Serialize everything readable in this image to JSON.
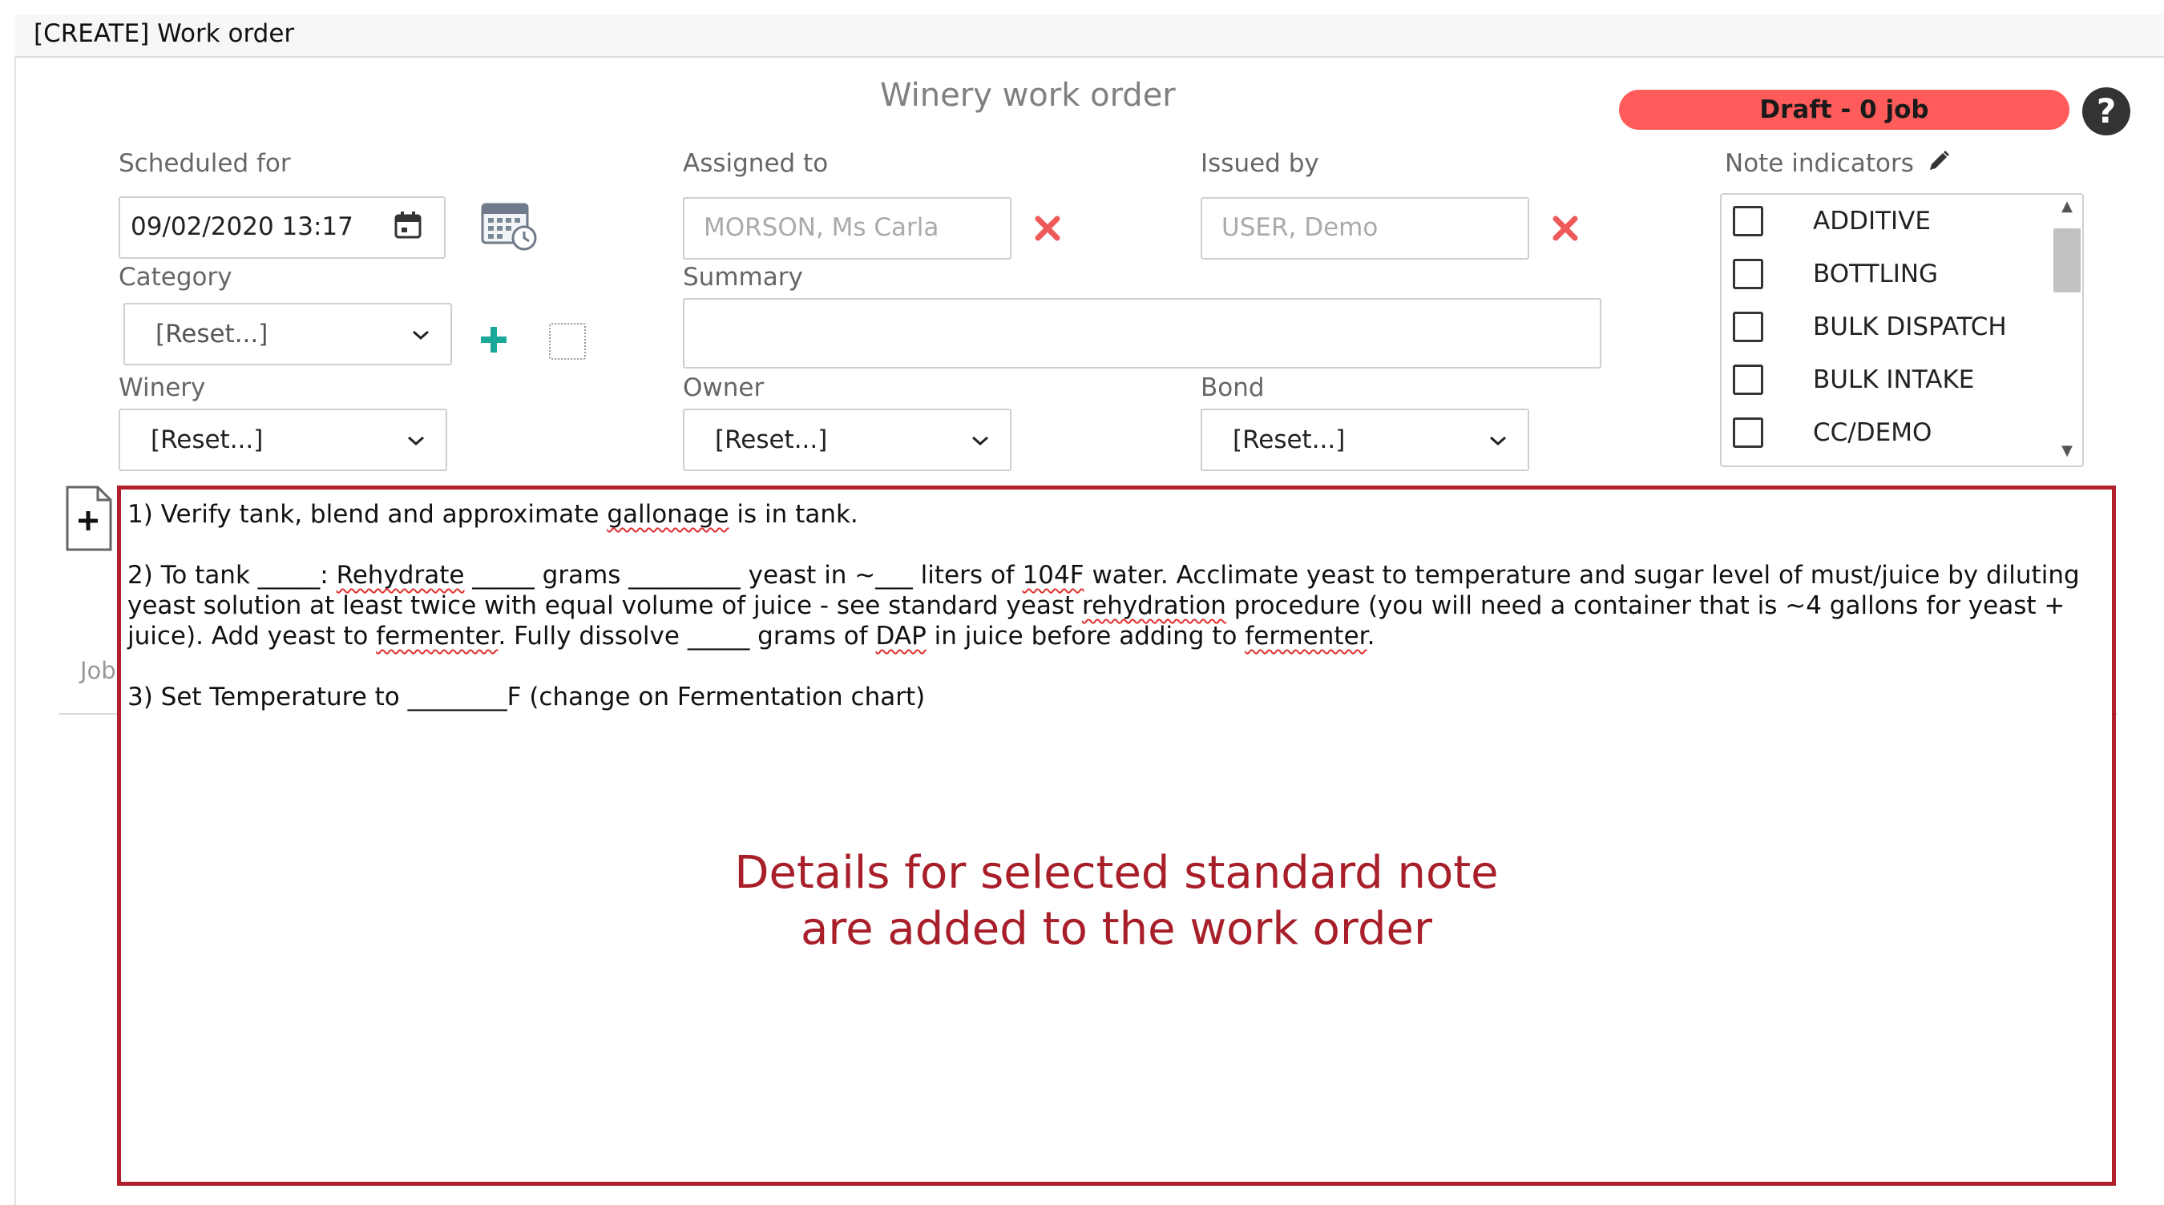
{
  "window": {
    "title": "[CREATE] Work order"
  },
  "header": {
    "title": "Winery work order",
    "status": "Draft - 0 job",
    "status_color": "#ff5b5b",
    "help_icon": "question-mark-icon"
  },
  "form": {
    "scheduled_for": {
      "label": "Scheduled for",
      "value": "09/02/2020 13:17"
    },
    "assigned_to": {
      "label": "Assigned to",
      "value": "MORSON, Ms Carla"
    },
    "issued_by": {
      "label": "Issued by",
      "value": "USER, Demo"
    },
    "category": {
      "label": "Category",
      "value": "[Reset...]"
    },
    "summary": {
      "label": "Summary",
      "value": ""
    },
    "winery": {
      "label": "Winery",
      "value": "[Reset...]"
    },
    "owner": {
      "label": "Owner",
      "value": "[Reset...]"
    },
    "bond": {
      "label": "Bond",
      "value": "[Reset...]"
    }
  },
  "note_indicators": {
    "label": "Note indicators",
    "items": [
      {
        "label": "ADDITIVE",
        "checked": false
      },
      {
        "label": "BOTTLING",
        "checked": false
      },
      {
        "label": "BULK DISPATCH",
        "checked": false
      },
      {
        "label": "BULK INTAKE",
        "checked": false
      },
      {
        "label": "CC/DEMO",
        "checked": false
      }
    ]
  },
  "tabs": {
    "job": "Job"
  },
  "note": {
    "line1": {
      "a": "1) Verify tank, blend and approximate ",
      "b": "gallonage",
      "c": " is in tank."
    },
    "line2": {
      "a": "2) To tank _____: ",
      "b": "Rehydrate",
      "c": " _____ grams _________ yeast in ~___ liters of ",
      "d": "104F",
      "e": " water.   Acclimate yeast to temperature and sugar level of must/juice by diluting yeast solution at least twice with equal volume of juice - see standard yeast ",
      "f": "rehydration",
      "g": " procedure (you will need a container that is ~4 gallons for yeast + juice).  Add yeast to ",
      "h": "fermenter",
      "i": ".  Fully dissolve _____ grams of ",
      "j": "DAP",
      "k": " in juice before adding to ",
      "l": "fermenter",
      "m": "."
    },
    "line3": "3) Set Temperature to ________F (change on Fermentation chart)"
  },
  "callout": {
    "line1": "Details for selected standard note",
    "line2": "are added to the work order",
    "color": "#a81f2a"
  }
}
